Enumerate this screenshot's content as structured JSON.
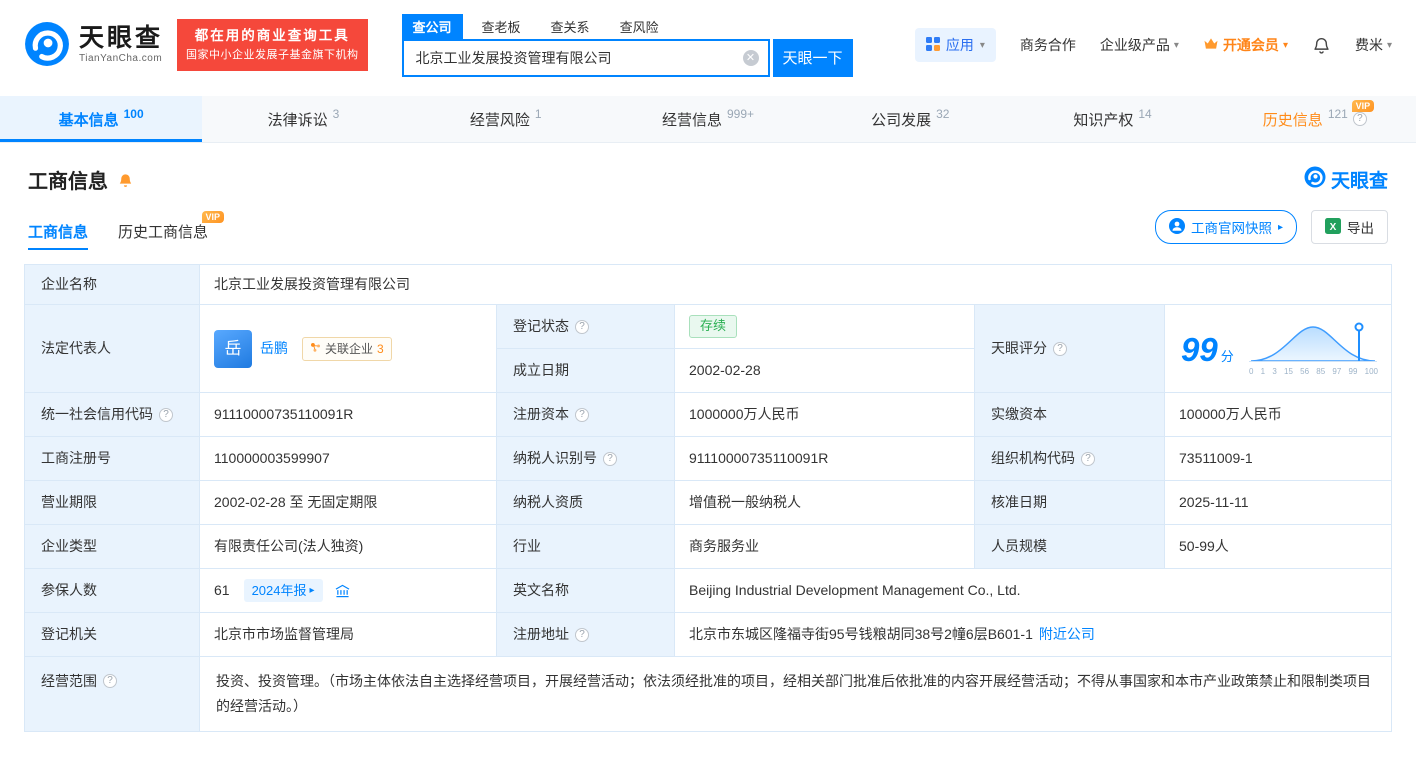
{
  "brand": {
    "name": "天眼查",
    "domain": "TianYanCha.com",
    "slogan_line1": "都在用的商业查询工具",
    "slogan_line2": "国家中小企业发展子基金旗下机构"
  },
  "search": {
    "tabs": [
      {
        "label": "查公司"
      },
      {
        "label": "查老板"
      },
      {
        "label": "查关系"
      },
      {
        "label": "查风险"
      }
    ],
    "value": "北京工业发展投资管理有限公司",
    "button": "天眼一下"
  },
  "topnav": {
    "app": "应用",
    "business": "商务合作",
    "enterprise": "企业级产品",
    "vip": "开通会员",
    "user": "费米"
  },
  "vip_badge": "VIP",
  "tabs": [
    {
      "label": "基本信息",
      "count": "100"
    },
    {
      "label": "法律诉讼",
      "count": "3"
    },
    {
      "label": "经营风险",
      "count": "1"
    },
    {
      "label": "经营信息",
      "count": "999+"
    },
    {
      "label": "公司发展",
      "count": "32"
    },
    {
      "label": "知识产权",
      "count": "14"
    },
    {
      "label": "历史信息",
      "count": "121"
    }
  ],
  "section": {
    "title": "工商信息",
    "brand": "天眼查",
    "subtab_current": "工商信息",
    "subtab_history": "历史工商信息",
    "snapshot_button": "工商官网快照",
    "export_button": "导出"
  },
  "info": {
    "company_name_label": "企业名称",
    "company_name": "北京工业发展投资管理有限公司",
    "legal_rep_label": "法定代表人",
    "avatar_char": "岳",
    "legal_rep": "岳鹏",
    "related_label": "关联企业",
    "related_count": "3",
    "reg_status_label": "登记状态",
    "reg_status": "存续",
    "establish_label": "成立日期",
    "establish_date": "2002-02-28",
    "score_label": "天眼评分",
    "score": "99",
    "score_unit": "分",
    "score_axis": "0 1 3 15 56 85 97 99 100",
    "credit_code_label": "统一社会信用代码",
    "credit_code": "91110000735110091R",
    "reg_capital_label": "注册资本",
    "reg_capital": "1000000万人民币",
    "paid_capital_label": "实缴资本",
    "paid_capital": "100000万人民币",
    "reg_number_label": "工商注册号",
    "reg_number": "110000003599907",
    "taxpayer_id_label": "纳税人识别号",
    "taxpayer_id": "91110000735110091R",
    "org_code_label": "组织机构代码",
    "org_code": "73511009-1",
    "business_term_label": "营业期限",
    "business_term": "2002-02-28 至 无固定期限",
    "taxpayer_quality_label": "纳税人资质",
    "taxpayer_quality": "增值税一般纳税人",
    "approval_date_label": "核准日期",
    "approval_date": "2025-11-11",
    "company_type_label": "企业类型",
    "company_type": "有限责任公司(法人独资)",
    "industry_label": "行业",
    "industry": "商务服务业",
    "staff_size_label": "人员规模",
    "staff_size": "50-99人",
    "insured_label": "参保人数",
    "insured": "61",
    "annual_report_badge": "2024年报",
    "english_name_label": "英文名称",
    "english_name": "Beijing Industrial Development Management Co., Ltd.",
    "reg_authority_label": "登记机关",
    "reg_authority": "北京市市场监督管理局",
    "address_label": "注册地址",
    "address": "北京市东城区隆福寺街95号钱粮胡同38号2幢6层B601-1",
    "nearby_link": "附近公司",
    "business_scope_label": "经营范围",
    "business_scope": "投资、投资管理。（市场主体依法自主选择经营项目，开展经营活动；依法须经批准的项目，经相关部门批准后依批准的内容开展经营活动；不得从事国家和本市产业政策禁止和限制类项目的经营活动。）"
  }
}
